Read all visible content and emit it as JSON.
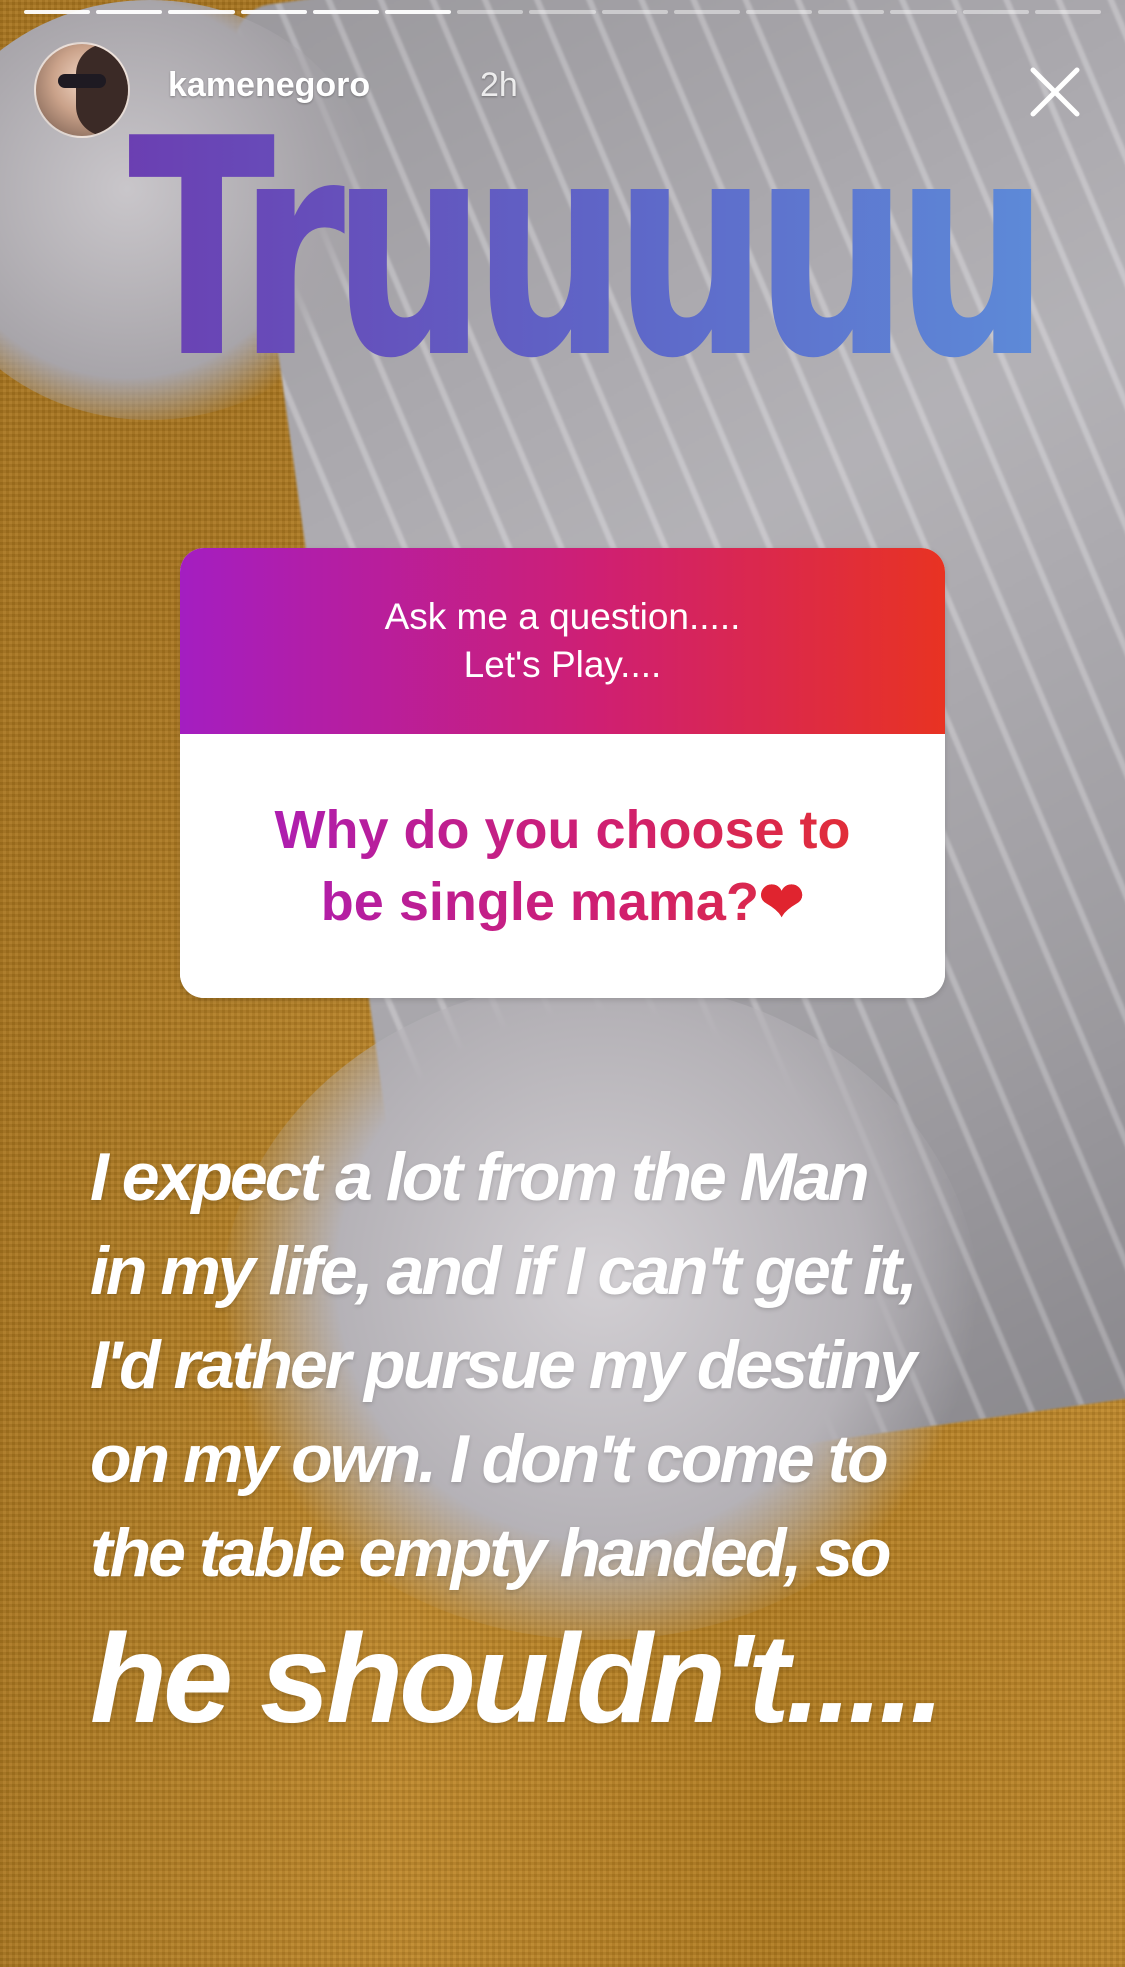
{
  "story": {
    "segments_total": 15,
    "segments_viewed": 6
  },
  "header": {
    "username": "kamenegoro",
    "time_ago": "2h",
    "close_icon": "close-icon"
  },
  "sticker_text": "Truuuuu",
  "question_sticker": {
    "prompt_line1": "Ask me a question.....",
    "prompt_line2": "Let's Play....",
    "question_line1": "Why do you choose to",
    "question_line2": "be single mama?",
    "question_emoji": "❤"
  },
  "answer": {
    "line1": "I expect a lot from the Man",
    "line2": "in my life, and if I can't get it,",
    "line3": "I'd rather pursue my destiny",
    "line4": "on my own. I don't come to",
    "line5": "the table empty handed, so",
    "line6": "he shouldn't....."
  }
}
